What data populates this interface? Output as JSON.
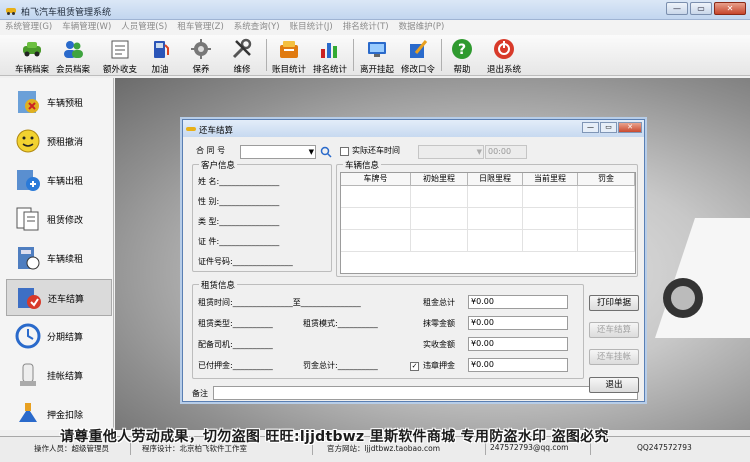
{
  "window": {
    "title": "柏飞汽车租赁管理系统",
    "min": "0",
    "max": "1",
    "close": "r"
  },
  "menu": [
    "系统管理(G)",
    "车辆管理(W)",
    "人员管理(S)",
    "租车管理(Z)",
    "系统查询(Y)",
    "账目统计(J)",
    "排名统计(T)",
    "数据维护(P)"
  ],
  "toolbar": [
    {
      "label": "车辆档案",
      "icon": "car-file-icon"
    },
    {
      "label": "会员档案",
      "icon": "member-file-icon"
    },
    {
      "label": "额外收支",
      "icon": "extra-income-icon"
    },
    {
      "label": "加油",
      "icon": "fuel-icon"
    },
    {
      "label": "保养",
      "icon": "maintenance-icon"
    },
    {
      "label": "维修",
      "icon": "repair-tools-icon"
    },
    {
      "label": "账目统计",
      "icon": "account-stats-icon"
    },
    {
      "label": "排名统计",
      "icon": "ranking-chart-icon"
    },
    {
      "label": "离开挂起",
      "icon": "suspend-icon"
    },
    {
      "label": "修改口令",
      "icon": "password-edit-icon"
    },
    {
      "label": "帮助",
      "icon": "help-icon"
    },
    {
      "label": "退出系统",
      "icon": "exit-icon"
    }
  ],
  "sidebar": [
    {
      "label": "车辆预租",
      "icon": "car-reserve-icon"
    },
    {
      "label": "预租撤消",
      "icon": "cancel-reserve-icon"
    },
    {
      "label": "车辆出租",
      "icon": "car-rent-out-icon"
    },
    {
      "label": "租赁修改",
      "icon": "rent-edit-icon"
    },
    {
      "label": "车辆续租",
      "icon": "renew-rent-icon"
    },
    {
      "label": "还车结算",
      "icon": "return-settle-icon"
    },
    {
      "label": "分期结算",
      "icon": "installment-icon"
    },
    {
      "label": "挂帐结算",
      "icon": "on-account-icon"
    },
    {
      "label": "押金扣除",
      "icon": "deposit-deduct-icon"
    }
  ],
  "dialog": {
    "title": "还车结算",
    "contract_label": "合 同 号",
    "actual_return_label": "实际还车时间",
    "time_value": "00:00",
    "customer_group": "客户信息",
    "customer_fields": [
      "姓    名:_______________",
      "性    别:_______________",
      "类    型:_______________",
      "证    件:_______________",
      "证件号码:_______________"
    ],
    "vehicle_group": "车辆信息",
    "vehicle_columns": [
      "车牌号",
      "初始里程",
      "日限里程",
      "当前里程",
      "罚金"
    ],
    "rent_group": "租赁信息",
    "rent_time": "租赁时间:_______________至_______________",
    "rent_type": "租赁类型:__________",
    "rent_mode": "租赁模式:__________",
    "driver": "配备司机:__________",
    "paid_deposit": "已付押金:__________",
    "fine_total": "罚金总计:__________",
    "amounts": [
      {
        "label": "租金总计",
        "value": "¥0.00"
      },
      {
        "label": "抹零金额",
        "value": "¥0.00"
      },
      {
        "label": "实收金额",
        "value": "¥0.00"
      },
      {
        "label": "违章押金",
        "value": "¥0.00"
      }
    ],
    "remark_label": "备注",
    "buttons": {
      "print": "打印单据",
      "settle": "还车结算",
      "pending": "还车挂帐",
      "exit": "退出"
    }
  },
  "status": {
    "operator": "操作人员：超级管理员",
    "designer": "程序设计：北京柏飞软件工作室",
    "website": "官方网站：ljjdtbwz.taobao.com",
    "qq1": "247572793@qq.com",
    "qq2": "QQ247572793"
  },
  "watermark": "请尊重他人劳动成果，切勿盗图 旺旺:ljjdtbwz 里斯软件商城 专用防盗水印 盗图必究"
}
